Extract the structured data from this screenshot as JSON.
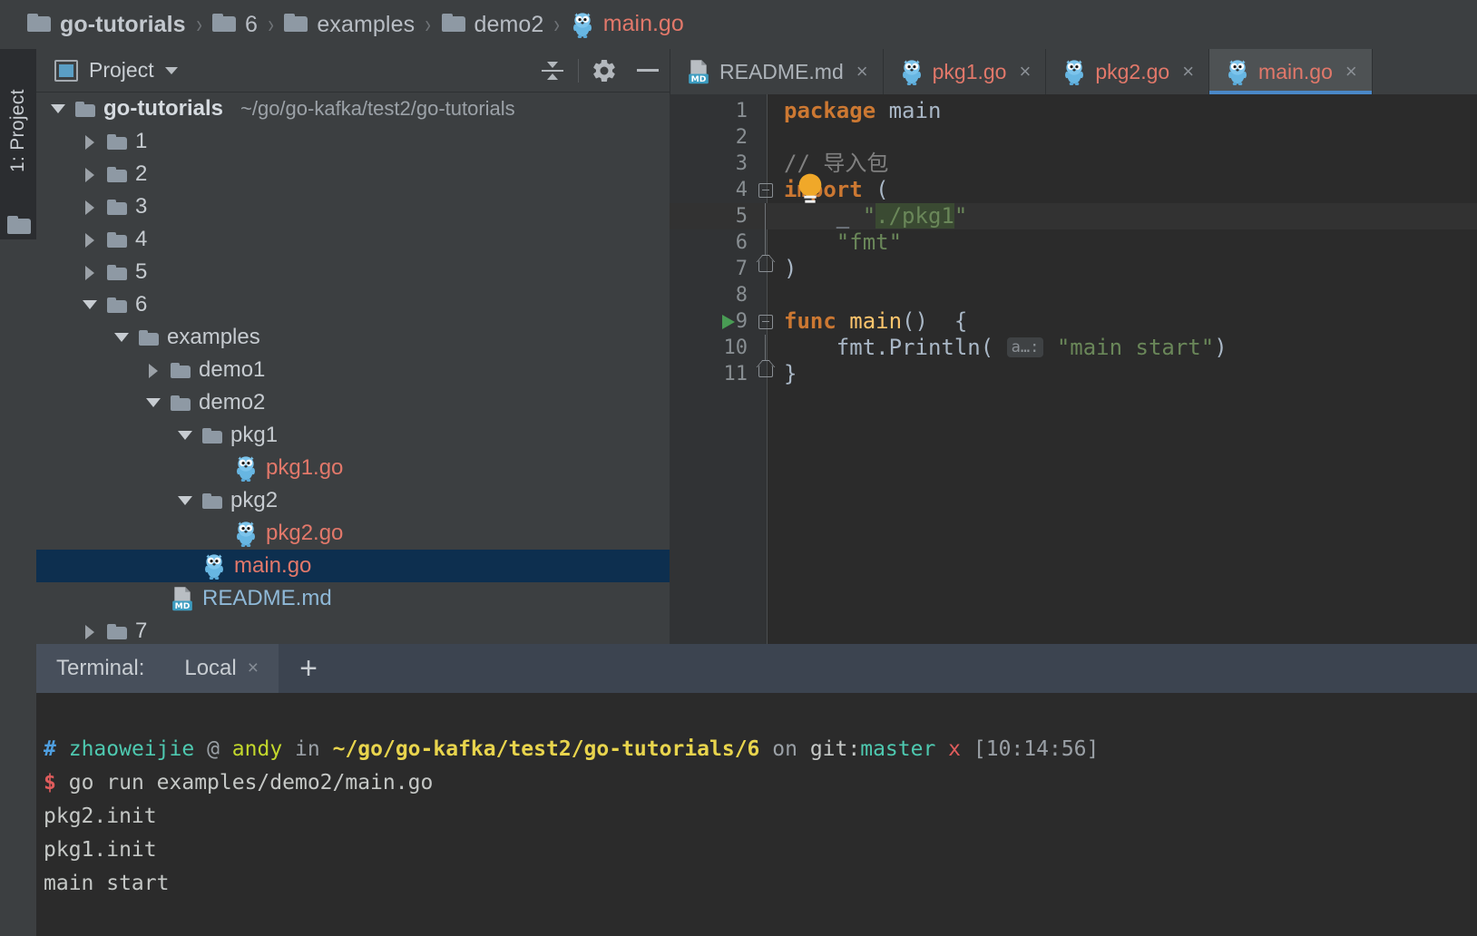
{
  "breadcrumb": {
    "items": [
      {
        "label": "go-tutorials",
        "icon": "folder-icon",
        "type": "folder"
      },
      {
        "label": "6",
        "icon": "folder-icon",
        "type": "folder"
      },
      {
        "label": "examples",
        "icon": "folder-icon",
        "type": "folder"
      },
      {
        "label": "demo2",
        "icon": "folder-icon",
        "type": "folder"
      },
      {
        "label": "main.go",
        "icon": "go-file-icon",
        "type": "gofile"
      }
    ],
    "separator": "›"
  },
  "tool_strip": {
    "project_label": "1: Project",
    "folder_icon": "folder-icon"
  },
  "project_panel": {
    "title": "Project",
    "window_icon": "project-window-icon",
    "caret_icon": "chevron-down-icon",
    "collapse_all_icon": "collapse-all-icon",
    "settings_icon": "gear-icon",
    "hide_icon": "minimize-icon",
    "tree": [
      {
        "label": "go-tutorials",
        "path": "~/go/go-kafka/test2/go-tutorials",
        "depth": 0,
        "twisty": "open",
        "kind": "root",
        "icon": "folder-icon"
      },
      {
        "label": "1",
        "path": "",
        "depth": 1,
        "twisty": "closed",
        "kind": "folder",
        "icon": "folder-icon"
      },
      {
        "label": "2",
        "path": "",
        "depth": 1,
        "twisty": "closed",
        "kind": "folder",
        "icon": "folder-icon"
      },
      {
        "label": "3",
        "path": "",
        "depth": 1,
        "twisty": "closed",
        "kind": "folder",
        "icon": "folder-icon"
      },
      {
        "label": "4",
        "path": "",
        "depth": 1,
        "twisty": "closed",
        "kind": "folder",
        "icon": "folder-icon"
      },
      {
        "label": "5",
        "path": "",
        "depth": 1,
        "twisty": "closed",
        "kind": "folder",
        "icon": "folder-icon"
      },
      {
        "label": "6",
        "path": "",
        "depth": 1,
        "twisty": "open",
        "kind": "folder",
        "icon": "folder-icon"
      },
      {
        "label": "examples",
        "path": "",
        "depth": 2,
        "twisty": "open",
        "kind": "folder",
        "icon": "folder-icon"
      },
      {
        "label": "demo1",
        "path": "",
        "depth": 3,
        "twisty": "closed",
        "kind": "folder",
        "icon": "folder-icon"
      },
      {
        "label": "demo2",
        "path": "",
        "depth": 3,
        "twisty": "open",
        "kind": "folder",
        "icon": "folder-icon"
      },
      {
        "label": "pkg1",
        "path": "",
        "depth": 4,
        "twisty": "open",
        "kind": "folder",
        "icon": "folder-icon"
      },
      {
        "label": "pkg1.go",
        "path": "",
        "depth": 5,
        "twisty": "none",
        "kind": "gofile",
        "icon": "go-file-icon"
      },
      {
        "label": "pkg2",
        "path": "",
        "depth": 4,
        "twisty": "open",
        "kind": "folder",
        "icon": "folder-icon"
      },
      {
        "label": "pkg2.go",
        "path": "",
        "depth": 5,
        "twisty": "none",
        "kind": "gofile",
        "icon": "go-file-icon"
      },
      {
        "label": "main.go",
        "path": "",
        "depth": 4,
        "twisty": "none",
        "kind": "gofile",
        "icon": "go-file-icon",
        "selected": true
      },
      {
        "label": "README.md",
        "path": "",
        "depth": 3,
        "twisty": "none",
        "kind": "mdfile",
        "icon": "md-file-icon"
      },
      {
        "label": "7",
        "path": "",
        "depth": 1,
        "twisty": "closed",
        "kind": "folder",
        "icon": "folder-icon"
      }
    ]
  },
  "editor": {
    "tabs": [
      {
        "label": "README.md",
        "icon": "md-file-icon",
        "active": false,
        "close": "×"
      },
      {
        "label": "pkg1.go",
        "icon": "go-file-icon",
        "active": false,
        "close": "×"
      },
      {
        "label": "pkg2.go",
        "icon": "go-file-icon",
        "active": false,
        "close": "×"
      },
      {
        "label": "main.go",
        "icon": "go-file-icon",
        "active": true,
        "close": "×"
      }
    ],
    "accent_color": "#4a88c7",
    "lines": [
      {
        "no": "1",
        "tokens": [
          {
            "t": "package ",
            "c": "kw"
          },
          {
            "t": "main",
            "c": "plain"
          }
        ]
      },
      {
        "no": "2",
        "tokens": []
      },
      {
        "no": "3",
        "tokens": [
          {
            "t": "// 导入包",
            "c": "cmt"
          }
        ]
      },
      {
        "no": "4",
        "tokens": [
          {
            "t": "import",
            "c": "kw"
          },
          {
            "t": " (",
            "c": "plain"
          }
        ],
        "fold": "start",
        "bulb": true
      },
      {
        "no": "5",
        "tokens": [
          {
            "t": "    _ ",
            "c": "plain"
          },
          {
            "t": "\"",
            "c": "str"
          },
          {
            "t": "./pkg1",
            "c": "str strhl"
          },
          {
            "t": "\"",
            "c": "str"
          }
        ],
        "fold": "mid",
        "highlight": true
      },
      {
        "no": "6",
        "tokens": [
          {
            "t": "    \"fmt\"",
            "c": "str"
          }
        ],
        "fold": "mid"
      },
      {
        "no": "7",
        "tokens": [
          {
            "t": ")",
            "c": "plain"
          }
        ],
        "fold": "end"
      },
      {
        "no": "8",
        "tokens": []
      },
      {
        "no": "9",
        "tokens": [
          {
            "t": "func ",
            "c": "kw"
          },
          {
            "t": "main",
            "c": "fn"
          },
          {
            "t": "()  {",
            "c": "plain"
          }
        ],
        "fold": "start",
        "run": true
      },
      {
        "no": "10",
        "tokens": [
          {
            "t": "    fmt.Println( ",
            "c": "plain"
          },
          {
            "t": "a…:",
            "c": "hint"
          },
          {
            "t": " ",
            "c": "plain"
          },
          {
            "t": "\"main start\"",
            "c": "str"
          },
          {
            "t": ")",
            "c": "plain"
          }
        ],
        "fold": "mid"
      },
      {
        "no": "11",
        "tokens": [
          {
            "t": "}",
            "c": "plain"
          }
        ],
        "fold": "end"
      }
    ]
  },
  "terminal": {
    "header_label": "Terminal:",
    "tab_label": "Local",
    "tab_close": "×",
    "add_label": "+",
    "prompt": {
      "hash": "#",
      "user": "zhaoweijie",
      "at": "@",
      "host": "andy",
      "in": "in",
      "path": "~/go/go-kafka/test2/go-tutorials/6",
      "on": "on",
      "git_prefix": "git:",
      "branch": "master",
      "dirty": "x",
      "time": "[10:14:56]"
    },
    "command_symbol": "$",
    "command": "go run examples/demo2/main.go",
    "output": [
      "pkg2.init",
      "pkg1.init",
      "main start"
    ]
  }
}
